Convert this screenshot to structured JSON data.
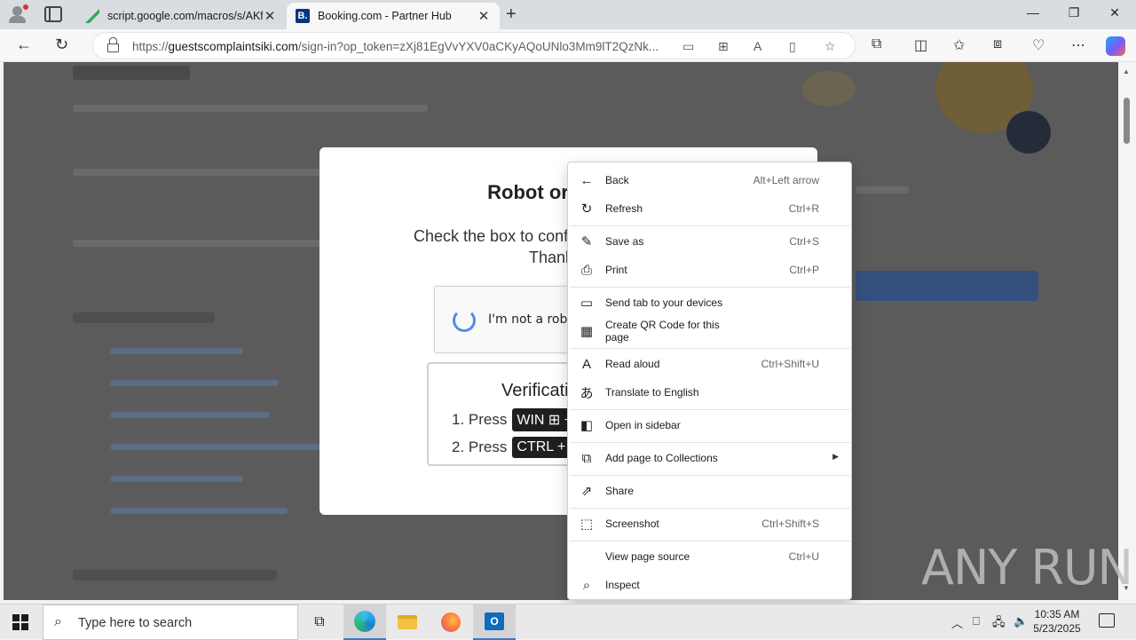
{
  "browser": {
    "tabs": [
      {
        "title": "script.google.com/macros/s/AKf",
        "favicon": "apps-script-icon"
      },
      {
        "title": "Booking.com - Partner Hub",
        "favicon": "booking-b-icon",
        "favicon_text": "B."
      }
    ],
    "url_prefix": "https://",
    "url_host": "guestscomplaintsiki.com",
    "url_path": "/sign-in?op_token=zXj81EgVvYXV0aCKyAQoUNlo3Mm9lT2QzNk..."
  },
  "modal": {
    "title": "Robot or",
    "line1": "Check the box to conf",
    "line2": "Thank",
    "captcha_label": "I'm not a robot",
    "verification_title": "Verificati",
    "step1_text": "1. Press",
    "step1_key": "WIN",
    "step1_plus": "+",
    "step2_text": "2. Press",
    "step2_key": "CTRL + V"
  },
  "context_menu": {
    "items": [
      {
        "label": "Back",
        "shortcut": "Alt+Left arrow",
        "icon": "back-arrow-icon"
      },
      {
        "label": "Refresh",
        "shortcut": "Ctrl+R",
        "icon": "refresh-icon"
      },
      {
        "label": "Save as",
        "shortcut": "Ctrl+S",
        "icon": "save-icon"
      },
      {
        "label": "Print",
        "shortcut": "Ctrl+P",
        "icon": "printer-icon"
      },
      {
        "label": "Send tab to your devices",
        "shortcut": "",
        "icon": "devices-icon"
      },
      {
        "label": "Create QR Code for this page",
        "shortcut": "",
        "icon": "qr-code-icon"
      },
      {
        "label": "Read aloud",
        "shortcut": "Ctrl+Shift+U",
        "icon": "read-aloud-icon"
      },
      {
        "label": "Translate to English",
        "shortcut": "",
        "icon": "translate-icon"
      },
      {
        "label": "Open in sidebar",
        "shortcut": "",
        "icon": "sidebar-icon"
      },
      {
        "label": "Add page to Collections",
        "shortcut": "",
        "icon": "collections-icon"
      },
      {
        "label": "Share",
        "shortcut": "",
        "icon": "share-icon"
      },
      {
        "label": "Screenshot",
        "shortcut": "Ctrl+Shift+S",
        "icon": "screenshot-icon"
      },
      {
        "label": "View page source",
        "shortcut": "Ctrl+U",
        "icon": ""
      },
      {
        "label": "Inspect",
        "shortcut": "",
        "icon": "inspect-icon"
      }
    ]
  },
  "watermark": "ANY RUN",
  "taskbar": {
    "search_placeholder": "Type here to search",
    "time": "10:35 AM",
    "date": "5/23/2025"
  },
  "colors": {
    "edge_accent": "#0078d4",
    "booking_blue": "#003580",
    "overlay": "#5b5b5b"
  }
}
